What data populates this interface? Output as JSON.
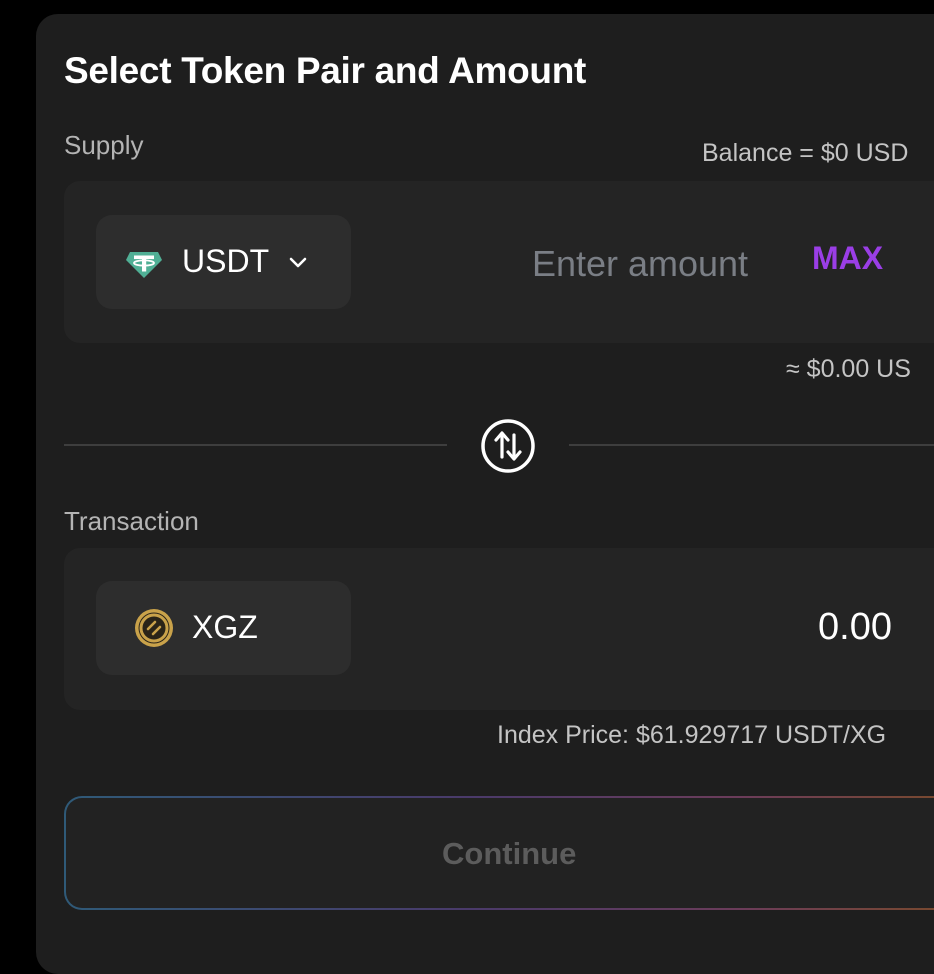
{
  "card": {
    "title": "Select Token Pair and Amount"
  },
  "supply": {
    "label": "Supply",
    "balance_text": "Balance = $0 USD",
    "token": {
      "symbol": "USDT",
      "icon": "tether-icon",
      "icon_color": "#50af95"
    },
    "amount_value": "",
    "amount_placeholder": "Enter amount",
    "max_label": "MAX",
    "max_color": "#9a3ee6",
    "usd_estimate": "≈ $0.00 US"
  },
  "swap": {
    "icon": "swap-arrows-icon"
  },
  "transaction": {
    "label": "Transaction",
    "token": {
      "symbol": "XGZ",
      "icon": "xgz-coin-icon",
      "icon_color": "#c9a24a"
    },
    "output_value": "0.00",
    "index_price": "Index Price: $61.929717 USDT/XG"
  },
  "continue_button": {
    "label": "Continue",
    "disabled": true
  }
}
